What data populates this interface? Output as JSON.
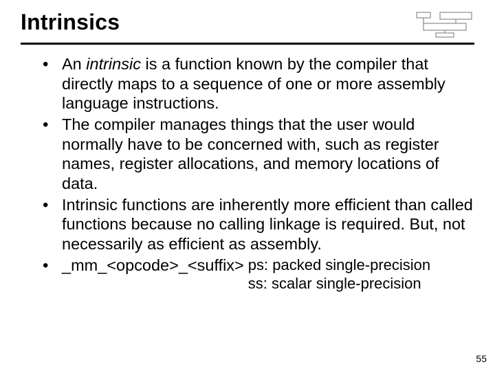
{
  "header": {
    "title": "Intrinsics"
  },
  "bullets": {
    "b1_pre": "An ",
    "b1_em": "intrinsic",
    "b1_post": " is a function known by the compiler that directly maps to a sequence of one or more assembly language instructions.",
    "b2": "The compiler manages things that the user would normally have to be concerned with, such as register names, register allocations, and memory locations of data.",
    "b3": "Intrinsic functions are inherently more efficient than called functions because no calling linkage is required. But, not necessarily as efficient as assembly.",
    "b4_label": "_mm_<opcode>_<suffix>",
    "b4_suffix1": "ps: packed single-precision",
    "b4_suffix2": "ss: scalar single-precision"
  },
  "page_number": "55"
}
